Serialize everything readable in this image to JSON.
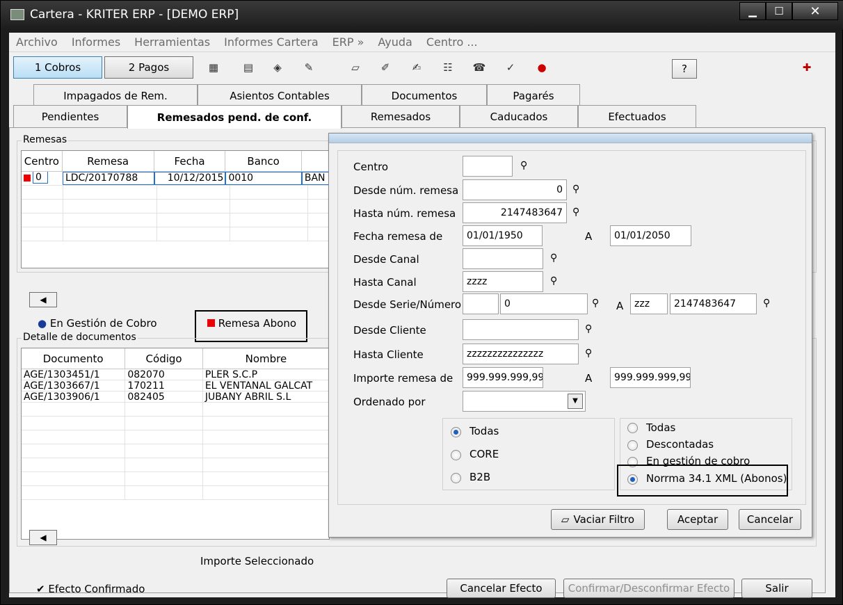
{
  "window": {
    "title": "Cartera - KRITER ERP - [DEMO ERP]"
  },
  "menu": [
    "Archivo",
    "Informes",
    "Herramientas",
    "Informes Cartera",
    "ERP »",
    "Ayuda",
    "Centro ..."
  ],
  "toolbar": {
    "cobros_label": "1 Cobros",
    "pagos_label": "2 Pagos",
    "help_label": "?"
  },
  "tabs_top": [
    "Impagados de Rem.",
    "Asientos Contables",
    "Documentos",
    "Pagarés"
  ],
  "tabs_bottom": [
    "Pendientes",
    "Remesados pend. de conf.",
    "Remesados",
    "Caducados",
    "Efectuados"
  ],
  "remesas": {
    "label": "Remesas",
    "columns": [
      "Centro",
      "Remesa",
      "Fecha",
      "Banco"
    ],
    "rows": [
      {
        "centro": "0",
        "remesa": "LDC/20170788",
        "fecha": "10/12/2015",
        "banco": "0010",
        "extra": "BAN"
      }
    ]
  },
  "legend": {
    "gestion": "En Gestión de Cobro",
    "abono": "Remesa Abono"
  },
  "detalle": {
    "label": "Detalle de documentos",
    "columns": [
      "Documento",
      "Código",
      "Nombre"
    ],
    "rows": [
      {
        "documento": "AGE/1303451/1",
        "codigo": "082070",
        "nombre": "PLER S.C.P"
      },
      {
        "documento": "AGE/1303667/1",
        "codigo": "170211",
        "nombre": "EL VENTANAL GALCAT"
      },
      {
        "documento": "AGE/1303906/1",
        "codigo": "082405",
        "nombre": "JUBANY ABRIL S.L"
      }
    ]
  },
  "bottom": {
    "importe_label": "Importe Seleccionado",
    "efecto_confirmado": "Efecto Confirmado",
    "cancelar_efecto": "Cancelar Efecto",
    "confirmar": "Confirmar/Desconfirmar Efecto",
    "salir": "Salir"
  },
  "filter": {
    "centro_label": "Centro",
    "centro_value": "",
    "desde_num_label": "Desde núm. remesa",
    "desde_num_value": "0",
    "hasta_num_label": "Hasta núm. remesa",
    "hasta_num_value": "2147483647",
    "fecha_label": "Fecha remesa  de",
    "fecha_desde": "01/01/1950",
    "a_label": "A",
    "fecha_hasta": "01/01/2050",
    "desde_canal_label": "Desde Canal",
    "desde_canal_value": "",
    "hasta_canal_label": "Hasta Canal",
    "hasta_canal_value": "zzzz",
    "desde_serie_label": "Desde Serie/Número",
    "desde_serie_value": "",
    "desde_numero_value": "0",
    "hasta_serie_value": "zzz",
    "hasta_numero_value": "2147483647",
    "desde_cliente_label": "Desde Cliente",
    "desde_cliente_value": "",
    "hasta_cliente_label": "Hasta Cliente",
    "hasta_cliente_value": "zzzzzzzzzzzzzzz",
    "importe_label": "Importe remesa de",
    "importe_desde": "999.999.999,99",
    "importe_hasta": "999.999.999,99",
    "ordenado_label": "Ordenado por",
    "ordenado_value": "",
    "tipo_options": [
      "Todas",
      "CORE",
      "B2B"
    ],
    "estado_options": [
      "Todas",
      "Descontadas",
      "En gestión de cobro",
      "Norrma 34.1 XML (Abonos)"
    ],
    "vaciar": "Vaciar Filtro",
    "aceptar": "Aceptar",
    "cancelar": "Cancelar"
  }
}
